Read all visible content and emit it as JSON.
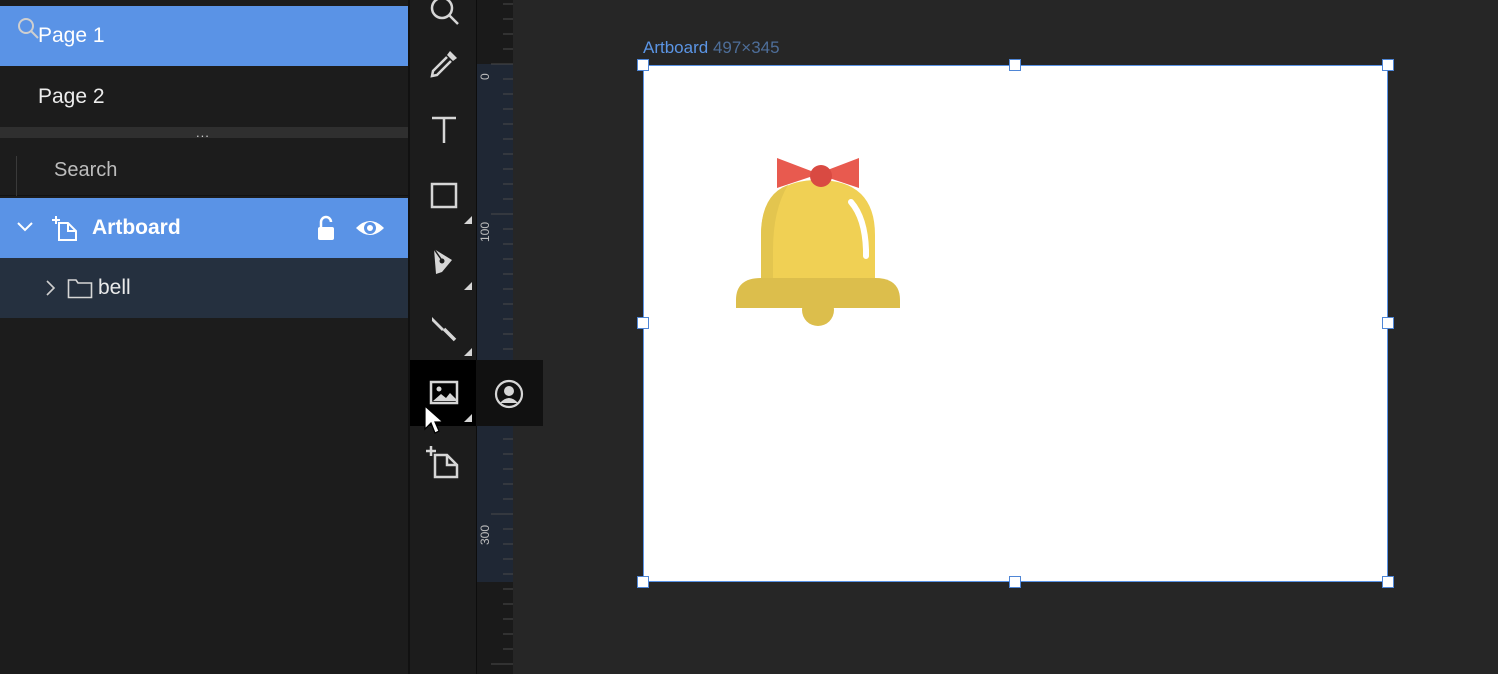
{
  "pages": [
    {
      "label": "Page 1",
      "selected": true
    },
    {
      "label": "Page 2",
      "selected": false
    }
  ],
  "splitter": {
    "dots": "..."
  },
  "search": {
    "placeholder": "Search"
  },
  "layers": {
    "artboard": {
      "name": "Artboard",
      "icon": "artboard-icon",
      "locked": false,
      "visible": true
    },
    "bell": {
      "name": "bell",
      "icon": "folder-icon"
    }
  },
  "tools": [
    "zoom-icon",
    "eyedropper-icon",
    "text-icon",
    "rectangle-icon",
    "pen-icon",
    "knife-icon",
    "image-icon",
    "artboard-icon"
  ],
  "flyout": {
    "icon": "avatar-icon"
  },
  "ruler": {
    "labels": [
      "0",
      "100",
      "300"
    ]
  },
  "canvas": {
    "artboard_name": "Artboard",
    "artboard_size": "497×345"
  },
  "colors": {
    "accent": "#5a93e6",
    "panel": "#1c1c1c",
    "canvas": "#262626",
    "bell_yellow": "#f0d054",
    "bell_shadow": "#dcbe4c",
    "bow_red": "#e85a4f"
  }
}
